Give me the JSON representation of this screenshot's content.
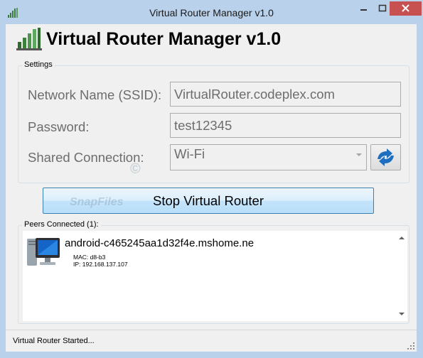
{
  "window": {
    "title": "Virtual Router Manager v1.0"
  },
  "header": {
    "title": "Virtual Router Manager v1.0"
  },
  "settings": {
    "legend": "Settings",
    "ssid_label": "Network Name (SSID):",
    "ssid_value": "VirtualRouter.codeplex.com",
    "password_label": "Password:",
    "password_value": "test12345",
    "shared_label": "Shared Connection:",
    "shared_value": "Wi-Fi"
  },
  "actions": {
    "stop_label": "Stop Virtual Router"
  },
  "peers": {
    "legend": "Peers Connected (1):",
    "items": [
      {
        "name": "android-c465245aa1d32f4e.mshome.ne",
        "mac": "MAC: d8-b3",
        "ip": "IP: 192.168.137.107"
      }
    ]
  },
  "status": {
    "text": "Virtual Router Started..."
  },
  "watermark": {
    "text": "SnapFiles",
    "symbol": "©"
  },
  "icons": {
    "app": "signal-bars-icon",
    "refresh": "refresh-arrows-icon",
    "peer": "computer-monitor-icon"
  },
  "colors": {
    "close": "#c75050",
    "title_bar": "#b9d1ea",
    "button_border": "#3c7fb1"
  }
}
